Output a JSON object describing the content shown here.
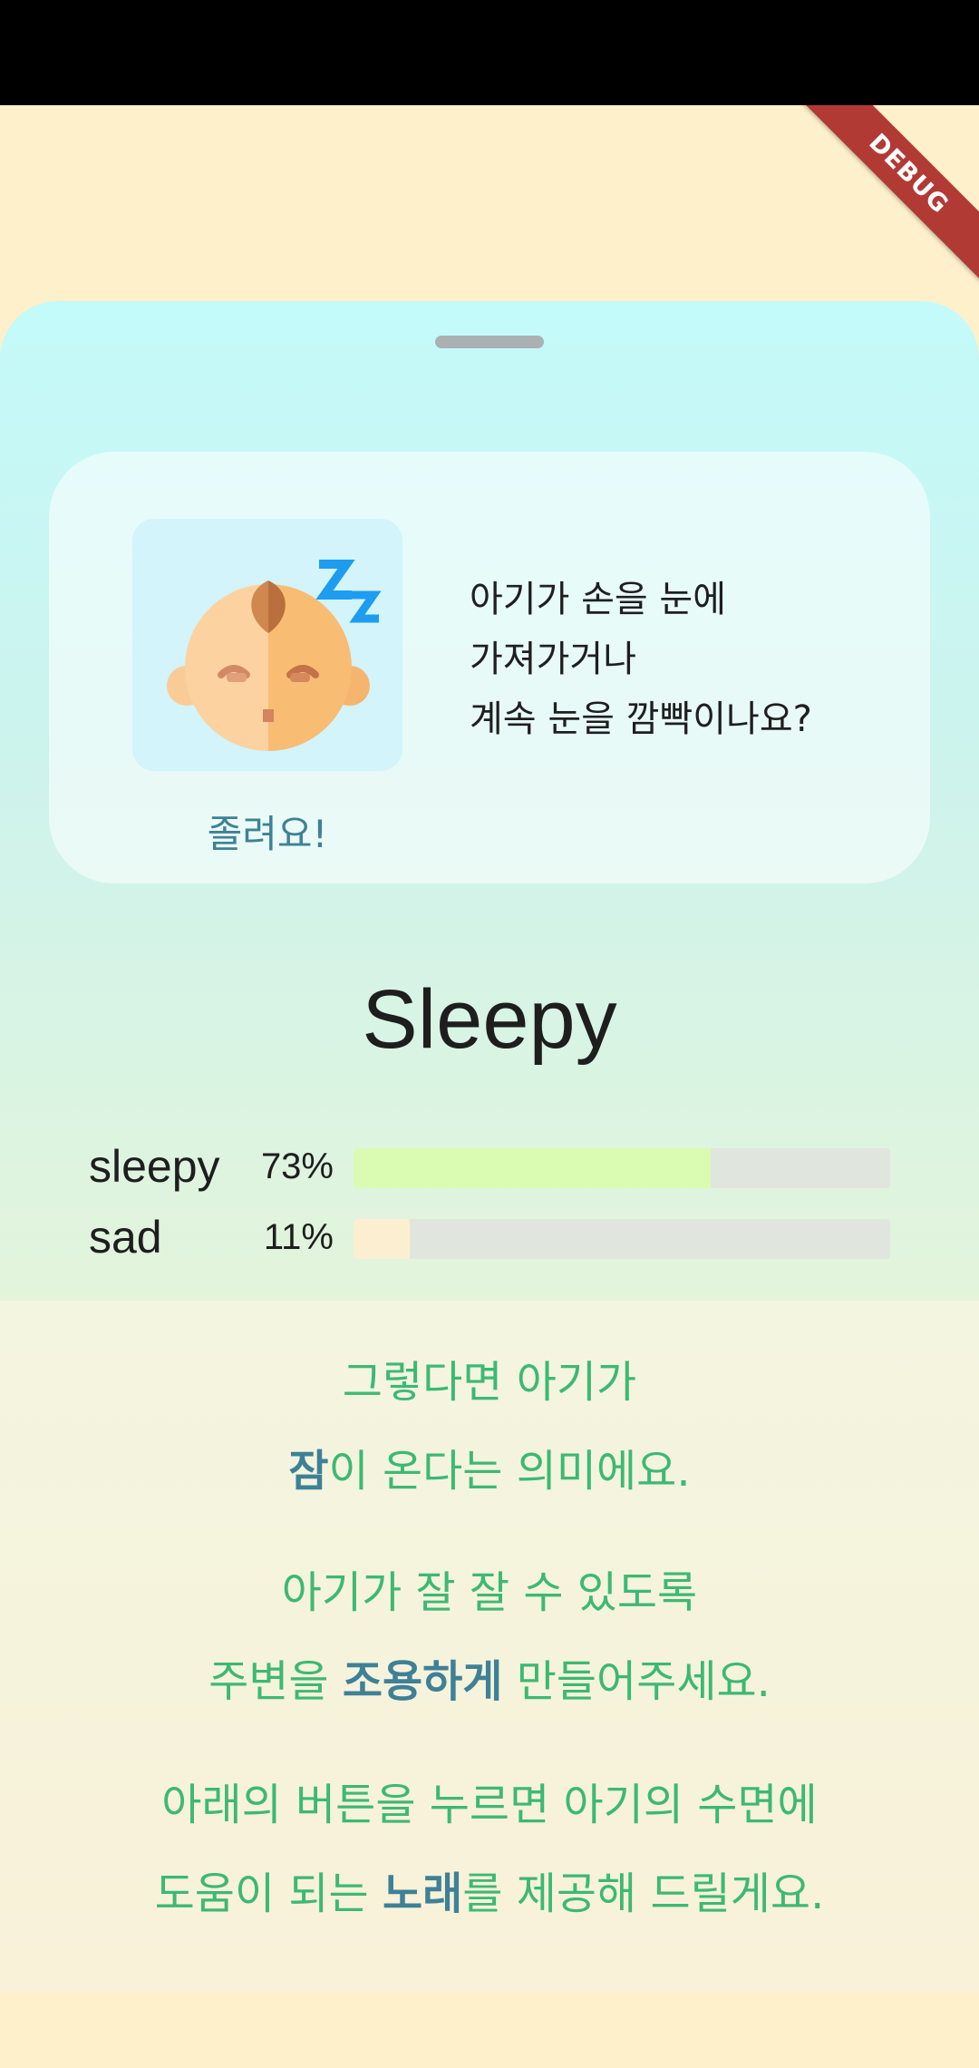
{
  "debug_banner": {
    "label": "DEBUG"
  },
  "card": {
    "tile_caption": "졸려요!",
    "question_lines": [
      "아기가 손을 눈에",
      "가져가거나",
      "계속 눈을 깜빡이나요?"
    ],
    "icon": "sleeping-baby-icon"
  },
  "result": {
    "label": "Sleepy"
  },
  "stats": [
    {
      "name": "sleepy",
      "percent_label": "73%",
      "fill_fraction": 0.665,
      "color": "#DAFBB2"
    },
    {
      "name": "sad",
      "percent_label": "11%",
      "fill_fraction": 0.105,
      "color": "#FCEED1"
    }
  ],
  "messages": {
    "line1": "그렇다면 아기가",
    "line2_hl": "잠",
    "line2_rest": "이 온다는 의미에요.",
    "line3": "아기가 잘 잘 수 있도록",
    "line4_pre": "주변을 ",
    "line4_hl": "조용하게",
    "line4_post": " 만들어주세요.",
    "line5": "아래의 버튼을 누르면 아기의 수면에",
    "line6_pre": "도움이 되는 ",
    "line6_hl": "노래",
    "line6_post": "를 제공해 드릴게요."
  },
  "colors": {
    "accent_text": "#3CB973",
    "highlight_text": "#3E8196",
    "debug_ribbon": "#B23A35"
  }
}
